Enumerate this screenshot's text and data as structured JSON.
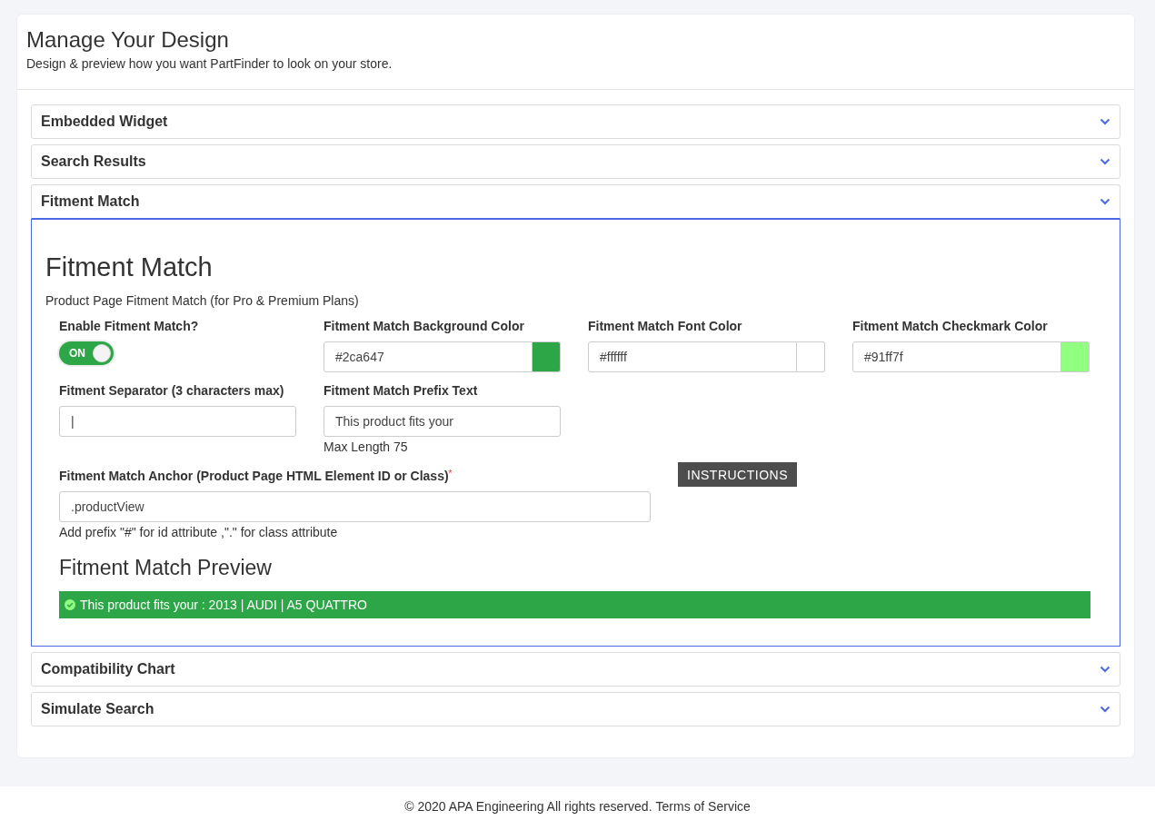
{
  "header": {
    "title": "Manage Your Design",
    "subtitle": "Design & preview how you want PartFinder to look on your store."
  },
  "sections": [
    {
      "title": "Embedded Widget",
      "expanded": false
    },
    {
      "title": "Search Results",
      "expanded": false
    },
    {
      "title": "Fitment Match",
      "expanded": true,
      "panel": {
        "heading": "Fitment Match",
        "subheading": "Product Page Fitment Match (for Pro & Premium Plans)",
        "toggle": {
          "label": "Enable Fitment Match?",
          "text": "ON",
          "on": true
        },
        "color_fields": [
          {
            "label": "Fitment Match Background Color",
            "value": "#2ca647",
            "color": "#2ca647"
          },
          {
            "label": "Fitment Match Font Color",
            "value": "#ffffff",
            "color": "#ffffff"
          },
          {
            "label": "Fitment Match Checkmark Color",
            "value": "#91ff7f",
            "color": "#91ff7f"
          }
        ],
        "separator": {
          "label": "Fitment Separator (3 characters max)",
          "value": "|"
        },
        "prefix": {
          "label": "Fitment Match Prefix Text",
          "value": "This product fits your",
          "hint": "Max Length 75"
        },
        "anchor": {
          "label": "Fitment Match Anchor (Product Page HTML Element ID or Class)",
          "required_mark": "*",
          "value": ".productView",
          "hint": "Add prefix \"#\" for id attribute ,\".\" for class attribute"
        },
        "instructions_button": "INSTRUCTIONS",
        "preview": {
          "title": "Fitment Match Preview",
          "text": "This product fits your : 2013 | AUDI | A5 QUATTRO"
        }
      }
    },
    {
      "title": "Compatibility Chart",
      "expanded": false
    },
    {
      "title": "Simulate Search",
      "expanded": false
    }
  ],
  "footer": {
    "copyright": "© 2020 APA Engineering All rights reserved.",
    "link": "Terms of Service"
  }
}
